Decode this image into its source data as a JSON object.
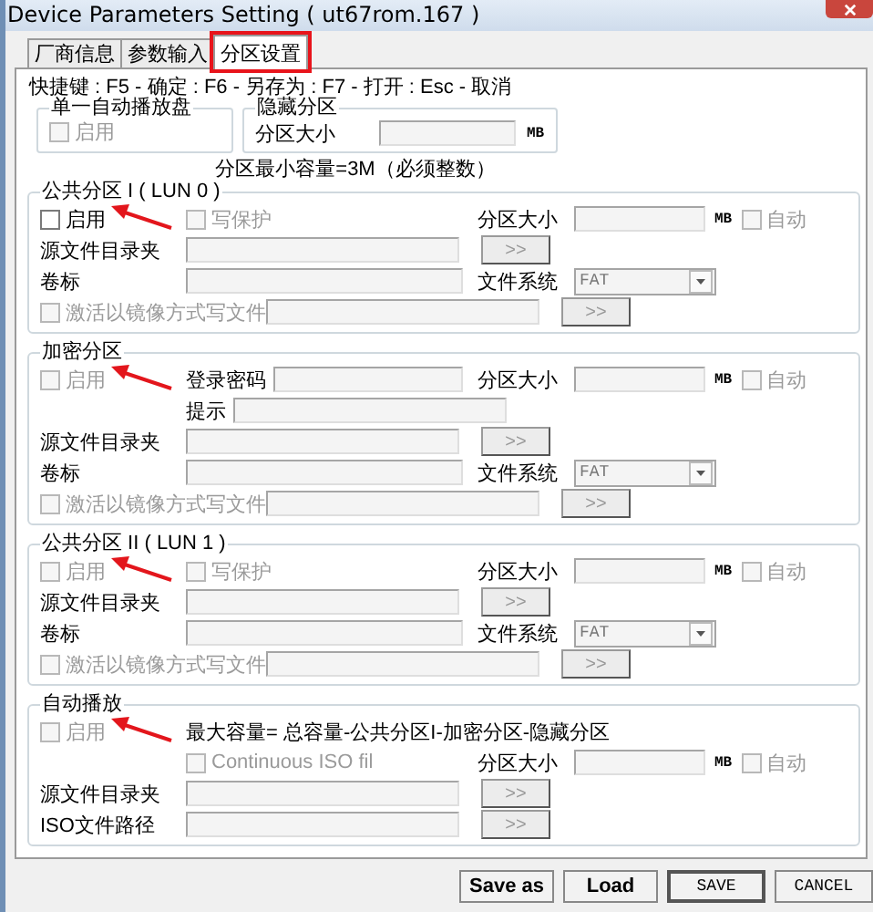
{
  "window": {
    "title": "Device Parameters Setting ( ut67rom.167 )"
  },
  "tabs": [
    {
      "label": "厂商信息",
      "selected": false,
      "highlighted": false
    },
    {
      "label": "参数输入",
      "selected": false,
      "highlighted": false
    },
    {
      "label": "分区设置",
      "selected": true,
      "highlighted": true
    }
  ],
  "shortcut_hint": "快捷键 : F5 - 确定 : F6 - 另存为 : F7 - 打开 : Esc - 取消",
  "single_autoplay_disk": {
    "title": "单一自动播放盘",
    "enable": {
      "label": "启用",
      "checked": false,
      "disabled": true
    }
  },
  "hidden_partition": {
    "title": "隐藏分区",
    "size_label": "分区大小",
    "unit": "MB"
  },
  "min_capacity_note": "分区最小容量=3M（必须整数）",
  "groups": [
    {
      "title": "公共分区 I ( LUN 0 )",
      "marked": true,
      "rows": [
        {
          "lead": [
            {
              "kind": "checkbox",
              "label": "启用",
              "checked": false,
              "disabled": false
            }
          ],
          "items": [
            {
              "kind": "checkbox",
              "label": "写保护",
              "checked": false,
              "disabled": true
            }
          ],
          "right": [
            {
              "kind": "label",
              "text": "分区大小"
            },
            {
              "kind": "field"
            },
            {
              "kind": "unit",
              "text": "MB"
            },
            {
              "kind": "checkbox",
              "label": "自动",
              "checked": false,
              "disabled": true
            }
          ]
        },
        {
          "lead": [
            {
              "kind": "label",
              "text": "源文件目录夹"
            }
          ],
          "items": [
            {
              "kind": "field"
            },
            {
              "kind": "browse",
              "label": ">>"
            }
          ],
          "right": []
        },
        {
          "lead": [
            {
              "kind": "label",
              "text": "卷标"
            }
          ],
          "items": [
            {
              "kind": "field"
            }
          ],
          "right": [
            {
              "kind": "label",
              "text": "文件系统"
            },
            {
              "kind": "select",
              "value": "FAT"
            }
          ]
        },
        {
          "lead": [
            {
              "kind": "checkbox",
              "label": "激活以镜像方式写文件",
              "checked": false,
              "disabled": true
            }
          ],
          "items": [
            {
              "kind": "field"
            },
            {
              "kind": "browse",
              "label": ">>"
            }
          ],
          "right": []
        }
      ]
    },
    {
      "title": "加密分区",
      "marked": true,
      "rows": [
        {
          "lead": [
            {
              "kind": "checkbox",
              "label": "启用",
              "checked": false,
              "disabled": true
            }
          ],
          "items": [
            {
              "kind": "label",
              "text": "登录密码"
            },
            {
              "kind": "field"
            }
          ],
          "right": [
            {
              "kind": "label",
              "text": "分区大小"
            },
            {
              "kind": "field"
            },
            {
              "kind": "unit",
              "text": "MB"
            },
            {
              "kind": "checkbox",
              "label": "自动",
              "checked": false,
              "disabled": true
            }
          ]
        },
        {
          "lead": [],
          "items": [
            {
              "kind": "label",
              "text": "提示"
            },
            {
              "kind": "field"
            }
          ],
          "right": []
        },
        {
          "lead": [
            {
              "kind": "label",
              "text": "源文件目录夹"
            }
          ],
          "items": [
            {
              "kind": "field"
            },
            {
              "kind": "browse",
              "label": ">>"
            }
          ],
          "right": []
        },
        {
          "lead": [
            {
              "kind": "label",
              "text": "卷标"
            }
          ],
          "items": [
            {
              "kind": "field"
            }
          ],
          "right": [
            {
              "kind": "label",
              "text": "文件系统"
            },
            {
              "kind": "select",
              "value": "FAT"
            }
          ]
        },
        {
          "lead": [
            {
              "kind": "checkbox",
              "label": "激活以镜像方式写文件",
              "checked": false,
              "disabled": true
            }
          ],
          "items": [
            {
              "kind": "field"
            },
            {
              "kind": "browse",
              "label": ">>"
            }
          ],
          "right": []
        }
      ]
    },
    {
      "title": "公共分区 II ( LUN 1 )",
      "marked": true,
      "rows": [
        {
          "lead": [
            {
              "kind": "checkbox",
              "label": "启用",
              "checked": false,
              "disabled": true
            }
          ],
          "items": [
            {
              "kind": "checkbox",
              "label": "写保护",
              "checked": false,
              "disabled": true
            }
          ],
          "right": [
            {
              "kind": "label",
              "text": "分区大小"
            },
            {
              "kind": "field"
            },
            {
              "kind": "unit",
              "text": "MB"
            },
            {
              "kind": "checkbox",
              "label": "自动",
              "checked": false,
              "disabled": true
            }
          ]
        },
        {
          "lead": [
            {
              "kind": "label",
              "text": "源文件目录夹"
            }
          ],
          "items": [
            {
              "kind": "field"
            },
            {
              "kind": "browse",
              "label": ">>"
            }
          ],
          "right": []
        },
        {
          "lead": [
            {
              "kind": "label",
              "text": "卷标"
            }
          ],
          "items": [
            {
              "kind": "field"
            }
          ],
          "right": [
            {
              "kind": "label",
              "text": "文件系统"
            },
            {
              "kind": "select",
              "value": "FAT"
            }
          ]
        },
        {
          "lead": [
            {
              "kind": "checkbox",
              "label": "激活以镜像方式写文件",
              "checked": false,
              "disabled": true
            }
          ],
          "items": [
            {
              "kind": "field"
            },
            {
              "kind": "browse",
              "label": ">>"
            }
          ],
          "right": []
        }
      ]
    },
    {
      "title": "自动播放",
      "marked": true,
      "rows": [
        {
          "lead": [
            {
              "kind": "checkbox",
              "label": "启用",
              "checked": false,
              "disabled": true
            }
          ],
          "items": [
            {
              "kind": "note",
              "text": "最大容量= 总容量-公共分区I-加密分区-隐藏分区"
            }
          ],
          "right": []
        },
        {
          "lead": [],
          "items": [
            {
              "kind": "checkbox",
              "label": "Continuous ISO fil",
              "checked": false,
              "disabled": true
            }
          ],
          "right": [
            {
              "kind": "label",
              "text": "分区大小"
            },
            {
              "kind": "field"
            },
            {
              "kind": "unit",
              "text": "MB"
            },
            {
              "kind": "checkbox",
              "label": "自动",
              "checked": false,
              "disabled": true
            }
          ]
        },
        {
          "lead": [
            {
              "kind": "label",
              "text": "源文件目录夹"
            }
          ],
          "items": [
            {
              "kind": "field"
            },
            {
              "kind": "browse",
              "label": ">>"
            }
          ],
          "right": []
        },
        {
          "lead": [
            {
              "kind": "label",
              "text": "ISO文件路径"
            }
          ],
          "items": [
            {
              "kind": "field"
            },
            {
              "kind": "browse",
              "label": ">>"
            }
          ],
          "right": []
        }
      ]
    }
  ],
  "buttons": [
    {
      "label": "Save as",
      "kind": "bold",
      "default": false
    },
    {
      "label": "Load",
      "kind": "bold",
      "default": false
    },
    {
      "label": "SAVE",
      "kind": "mono",
      "default": true
    },
    {
      "label": "CANCEL",
      "kind": "mono",
      "default": false
    }
  ]
}
